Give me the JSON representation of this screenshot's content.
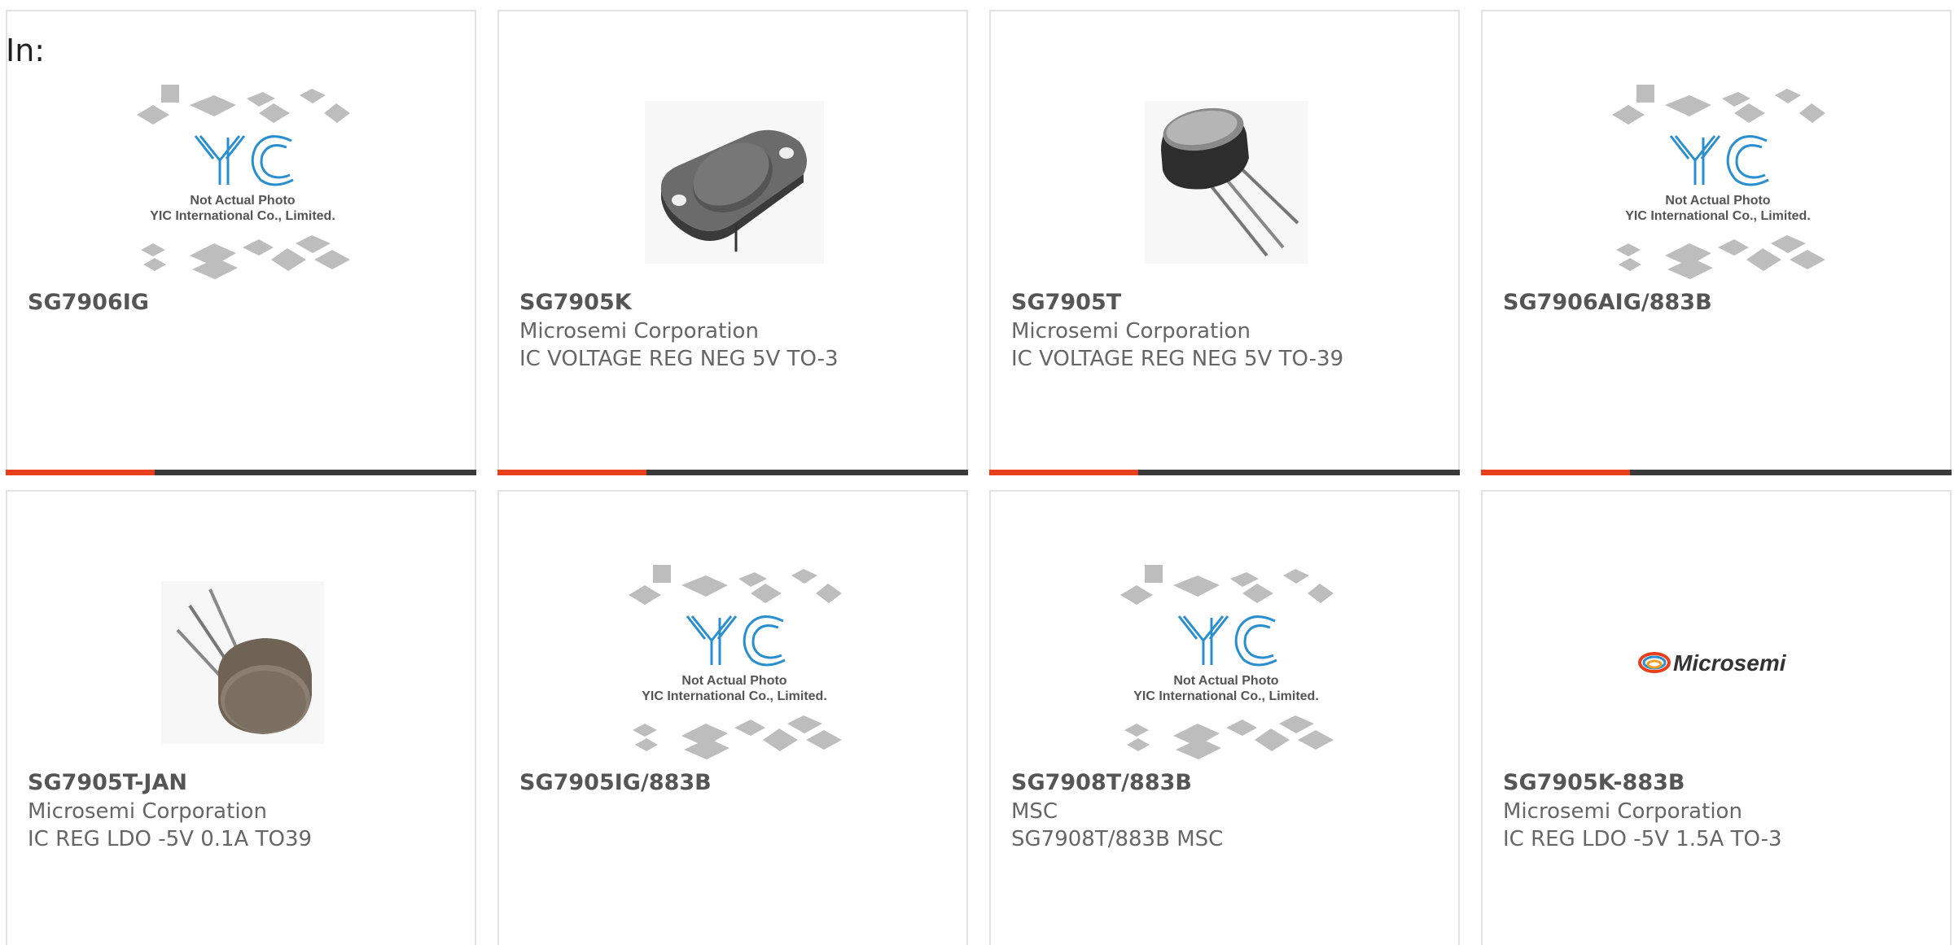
{
  "header": {
    "in_label": "In:"
  },
  "products": [
    {
      "part": "SG7906IG",
      "manufacturer": "",
      "description": "",
      "image": "yic-placeholder",
      "placeholder_line1": "Not Actual Photo",
      "placeholder_line2": "YIC International Co., Limited."
    },
    {
      "part": "SG7905K",
      "manufacturer": "Microsemi Corporation",
      "description": "IC VOLTAGE REG NEG 5V TO-3",
      "image": "to3-package"
    },
    {
      "part": "SG7905T",
      "manufacturer": "Microsemi Corporation",
      "description": "IC VOLTAGE REG NEG 5V TO-39",
      "image": "to39-package"
    },
    {
      "part": "SG7906AIG/883B",
      "manufacturer": "",
      "description": "",
      "image": "yic-placeholder",
      "placeholder_line1": "Not Actual Photo",
      "placeholder_line2": "YIC International Co., Limited."
    },
    {
      "part": "SG7905T-JAN",
      "manufacturer": "Microsemi Corporation",
      "description": "IC REG LDO -5V 0.1A TO39",
      "image": "to39-can"
    },
    {
      "part": "SG7905IG/883B",
      "manufacturer": "",
      "description": "",
      "image": "yic-placeholder",
      "placeholder_line1": "Not Actual Photo",
      "placeholder_line2": "YIC International Co., Limited."
    },
    {
      "part": "SG7908T/883B",
      "manufacturer": "MSC",
      "description": "SG7908T/883B MSC",
      "image": "yic-placeholder",
      "placeholder_line1": "Not Actual Photo",
      "placeholder_line2": "YIC International Co., Limited."
    },
    {
      "part": "SG7905K-883B",
      "manufacturer": "Microsemi Corporation",
      "description": "IC REG LDO -5V 1.5A TO-3",
      "image": "microsemi-logo",
      "logo_text": "Microsemi"
    }
  ],
  "colors": {
    "accent": "#e8401c",
    "bar": "#3a3a3a",
    "text": "#666666",
    "border": "#e2e2e2",
    "logo_blue": "#2a8fd0"
  }
}
